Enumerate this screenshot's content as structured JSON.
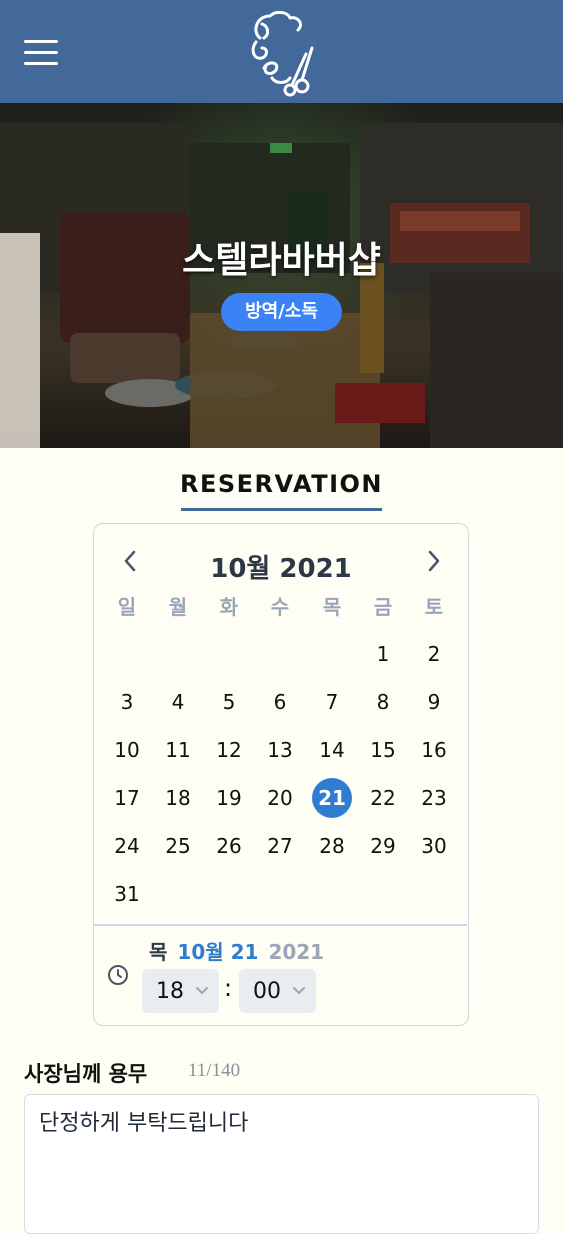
{
  "header": {
    "menu_icon": "hamburger-menu-icon",
    "logo_icon": "barber-scissors-logo-icon",
    "background": "#43699a"
  },
  "hero": {
    "title": "스텔라바버샵",
    "badge": "방역/소독",
    "badge_color": "#3b82f6"
  },
  "section": {
    "title": "RESERVATION"
  },
  "calendar": {
    "month_label": "10월 2021",
    "prev_icon": "chevron-left-icon",
    "next_icon": "chevron-right-icon",
    "weekdays": [
      "일",
      "월",
      "화",
      "수",
      "목",
      "금",
      "토"
    ],
    "first_weekday_index": 5,
    "days_in_month": 31,
    "days": [
      "1",
      "2",
      "3",
      "4",
      "5",
      "6",
      "7",
      "8",
      "9",
      "10",
      "11",
      "12",
      "13",
      "14",
      "15",
      "16",
      "17",
      "18",
      "19",
      "20",
      "21",
      "22",
      "23",
      "24",
      "25",
      "26",
      "27",
      "28",
      "29",
      "30",
      "31"
    ],
    "selected_day": "21",
    "selected_color": "#2f7dd0"
  },
  "time": {
    "clock_icon": "clock-icon",
    "weekday": "목",
    "month_day": "10월 21",
    "year": "2021",
    "hour": "18",
    "separator": ":",
    "minute": "00",
    "dropdown_icon": "chevron-down-icon"
  },
  "memo": {
    "label": "사장님께 용무",
    "count": "11/140",
    "value": "단정하게 부탁드립니다"
  }
}
